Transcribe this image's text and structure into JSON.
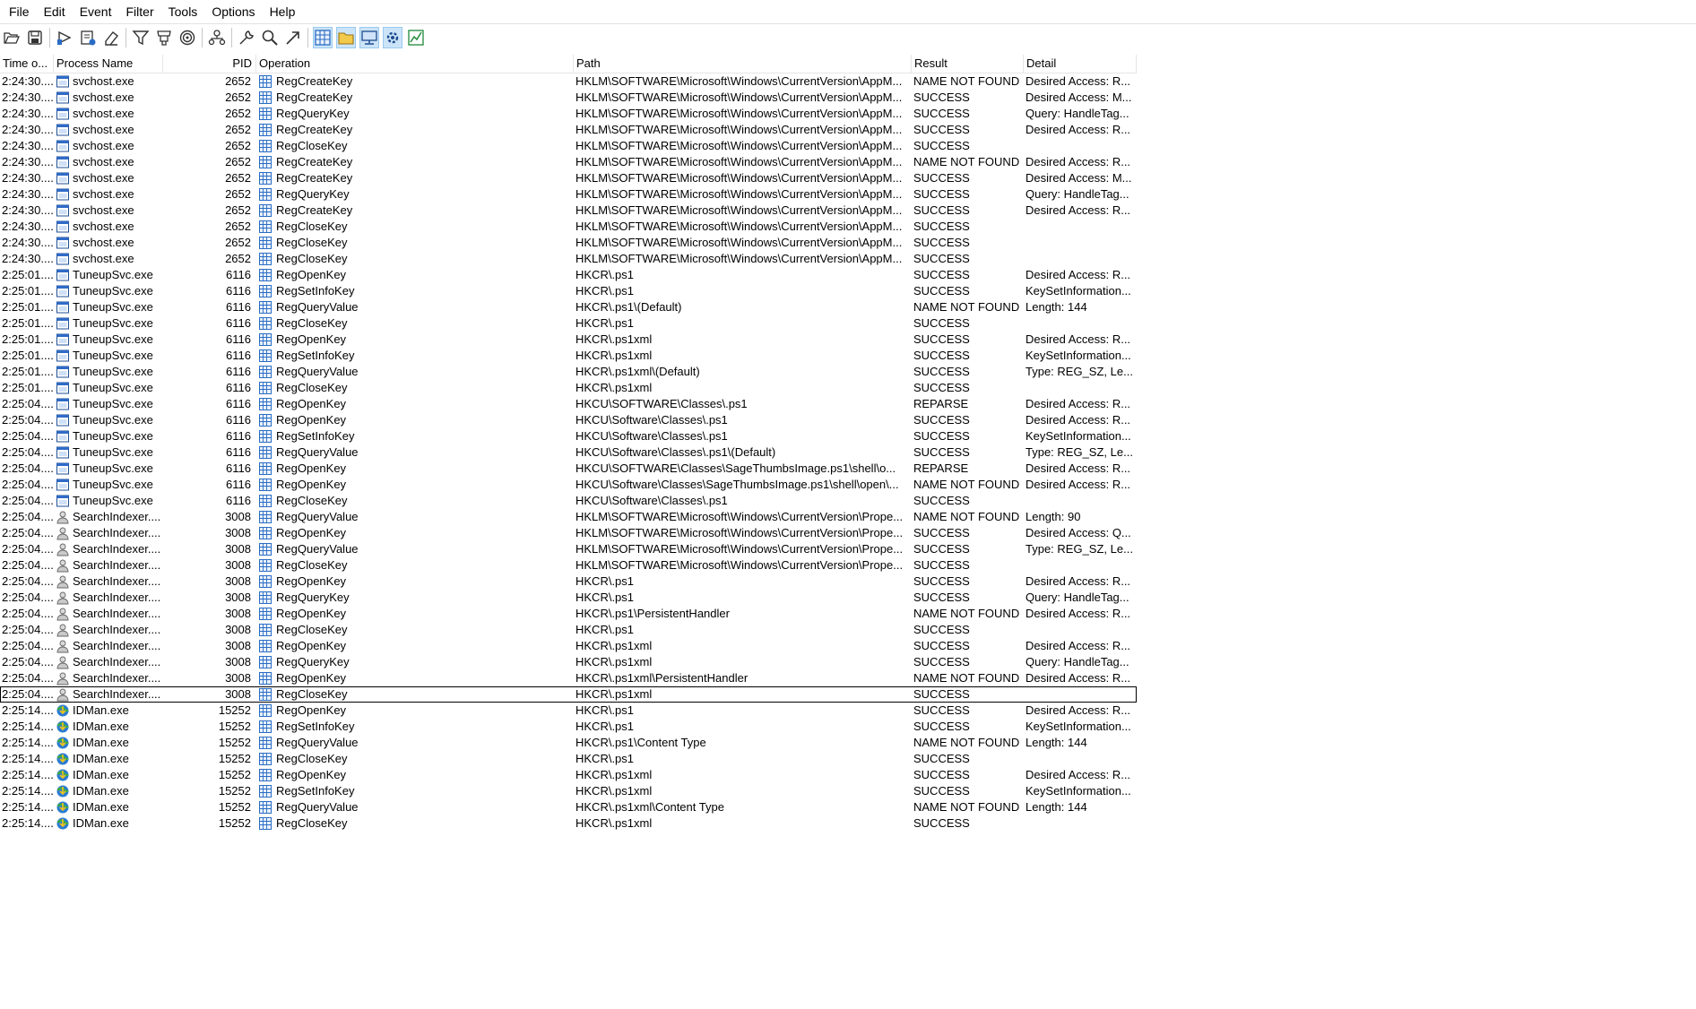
{
  "menu": [
    "File",
    "Edit",
    "Event",
    "Filter",
    "Tools",
    "Options",
    "Help"
  ],
  "columns": {
    "time": "Time o...",
    "process": "Process Name",
    "pid": "PID",
    "operation": "Operation",
    "path": "Path",
    "result": "Result",
    "detail": "Detail"
  },
  "rows": [
    {
      "time": "2:24:30....",
      "proc": "svchost.exe",
      "icon": "svchost-icon",
      "pid": "2652",
      "op": "RegCreateKey",
      "path": "HKLM\\SOFTWARE\\Microsoft\\Windows\\CurrentVersion\\AppM...",
      "result": "NAME NOT FOUND",
      "detail": "Desired Access: R..."
    },
    {
      "time": "2:24:30....",
      "proc": "svchost.exe",
      "icon": "svchost-icon",
      "pid": "2652",
      "op": "RegCreateKey",
      "path": "HKLM\\SOFTWARE\\Microsoft\\Windows\\CurrentVersion\\AppM...",
      "result": "SUCCESS",
      "detail": "Desired Access: M..."
    },
    {
      "time": "2:24:30....",
      "proc": "svchost.exe",
      "icon": "svchost-icon",
      "pid": "2652",
      "op": "RegQueryKey",
      "path": "HKLM\\SOFTWARE\\Microsoft\\Windows\\CurrentVersion\\AppM...",
      "result": "SUCCESS",
      "detail": "Query: HandleTag..."
    },
    {
      "time": "2:24:30....",
      "proc": "svchost.exe",
      "icon": "svchost-icon",
      "pid": "2652",
      "op": "RegCreateKey",
      "path": "HKLM\\SOFTWARE\\Microsoft\\Windows\\CurrentVersion\\AppM...",
      "result": "SUCCESS",
      "detail": "Desired Access: R..."
    },
    {
      "time": "2:24:30....",
      "proc": "svchost.exe",
      "icon": "svchost-icon",
      "pid": "2652",
      "op": "RegCloseKey",
      "path": "HKLM\\SOFTWARE\\Microsoft\\Windows\\CurrentVersion\\AppM...",
      "result": "SUCCESS",
      "detail": ""
    },
    {
      "time": "2:24:30....",
      "proc": "svchost.exe",
      "icon": "svchost-icon",
      "pid": "2652",
      "op": "RegCreateKey",
      "path": "HKLM\\SOFTWARE\\Microsoft\\Windows\\CurrentVersion\\AppM...",
      "result": "NAME NOT FOUND",
      "detail": "Desired Access: R..."
    },
    {
      "time": "2:24:30....",
      "proc": "svchost.exe",
      "icon": "svchost-icon",
      "pid": "2652",
      "op": "RegCreateKey",
      "path": "HKLM\\SOFTWARE\\Microsoft\\Windows\\CurrentVersion\\AppM...",
      "result": "SUCCESS",
      "detail": "Desired Access: M..."
    },
    {
      "time": "2:24:30....",
      "proc": "svchost.exe",
      "icon": "svchost-icon",
      "pid": "2652",
      "op": "RegQueryKey",
      "path": "HKLM\\SOFTWARE\\Microsoft\\Windows\\CurrentVersion\\AppM...",
      "result": "SUCCESS",
      "detail": "Query: HandleTag..."
    },
    {
      "time": "2:24:30....",
      "proc": "svchost.exe",
      "icon": "svchost-icon",
      "pid": "2652",
      "op": "RegCreateKey",
      "path": "HKLM\\SOFTWARE\\Microsoft\\Windows\\CurrentVersion\\AppM...",
      "result": "SUCCESS",
      "detail": "Desired Access: R..."
    },
    {
      "time": "2:24:30....",
      "proc": "svchost.exe",
      "icon": "svchost-icon",
      "pid": "2652",
      "op": "RegCloseKey",
      "path": "HKLM\\SOFTWARE\\Microsoft\\Windows\\CurrentVersion\\AppM...",
      "result": "SUCCESS",
      "detail": ""
    },
    {
      "time": "2:24:30....",
      "proc": "svchost.exe",
      "icon": "svchost-icon",
      "pid": "2652",
      "op": "RegCloseKey",
      "path": "HKLM\\SOFTWARE\\Microsoft\\Windows\\CurrentVersion\\AppM...",
      "result": "SUCCESS",
      "detail": ""
    },
    {
      "time": "2:24:30....",
      "proc": "svchost.exe",
      "icon": "svchost-icon",
      "pid": "2652",
      "op": "RegCloseKey",
      "path": "HKLM\\SOFTWARE\\Microsoft\\Windows\\CurrentVersion\\AppM...",
      "result": "SUCCESS",
      "detail": ""
    },
    {
      "time": "2:25:01....",
      "proc": "TuneupSvc.exe",
      "icon": "svchost-icon",
      "pid": "6116",
      "op": "RegOpenKey",
      "path": "HKCR\\.ps1",
      "result": "SUCCESS",
      "detail": "Desired Access: R..."
    },
    {
      "time": "2:25:01....",
      "proc": "TuneupSvc.exe",
      "icon": "svchost-icon",
      "pid": "6116",
      "op": "RegSetInfoKey",
      "path": "HKCR\\.ps1",
      "result": "SUCCESS",
      "detail": "KeySetInformation..."
    },
    {
      "time": "2:25:01....",
      "proc": "TuneupSvc.exe",
      "icon": "svchost-icon",
      "pid": "6116",
      "op": "RegQueryValue",
      "path": "HKCR\\.ps1\\(Default)",
      "result": "NAME NOT FOUND",
      "detail": "Length: 144"
    },
    {
      "time": "2:25:01....",
      "proc": "TuneupSvc.exe",
      "icon": "svchost-icon",
      "pid": "6116",
      "op": "RegCloseKey",
      "path": "HKCR\\.ps1",
      "result": "SUCCESS",
      "detail": ""
    },
    {
      "time": "2:25:01....",
      "proc": "TuneupSvc.exe",
      "icon": "svchost-icon",
      "pid": "6116",
      "op": "RegOpenKey",
      "path": "HKCR\\.ps1xml",
      "result": "SUCCESS",
      "detail": "Desired Access: R..."
    },
    {
      "time": "2:25:01....",
      "proc": "TuneupSvc.exe",
      "icon": "svchost-icon",
      "pid": "6116",
      "op": "RegSetInfoKey",
      "path": "HKCR\\.ps1xml",
      "result": "SUCCESS",
      "detail": "KeySetInformation..."
    },
    {
      "time": "2:25:01....",
      "proc": "TuneupSvc.exe",
      "icon": "svchost-icon",
      "pid": "6116",
      "op": "RegQueryValue",
      "path": "HKCR\\.ps1xml\\(Default)",
      "result": "SUCCESS",
      "detail": "Type: REG_SZ, Le..."
    },
    {
      "time": "2:25:01....",
      "proc": "TuneupSvc.exe",
      "icon": "svchost-icon",
      "pid": "6116",
      "op": "RegCloseKey",
      "path": "HKCR\\.ps1xml",
      "result": "SUCCESS",
      "detail": ""
    },
    {
      "time": "2:25:04....",
      "proc": "TuneupSvc.exe",
      "icon": "svchost-icon",
      "pid": "6116",
      "op": "RegOpenKey",
      "path": "HKCU\\SOFTWARE\\Classes\\.ps1",
      "result": "REPARSE",
      "detail": "Desired Access: R..."
    },
    {
      "time": "2:25:04....",
      "proc": "TuneupSvc.exe",
      "icon": "svchost-icon",
      "pid": "6116",
      "op": "RegOpenKey",
      "path": "HKCU\\Software\\Classes\\.ps1",
      "result": "SUCCESS",
      "detail": "Desired Access: R..."
    },
    {
      "time": "2:25:04....",
      "proc": "TuneupSvc.exe",
      "icon": "svchost-icon",
      "pid": "6116",
      "op": "RegSetInfoKey",
      "path": "HKCU\\Software\\Classes\\.ps1",
      "result": "SUCCESS",
      "detail": "KeySetInformation..."
    },
    {
      "time": "2:25:04....",
      "proc": "TuneupSvc.exe",
      "icon": "svchost-icon",
      "pid": "6116",
      "op": "RegQueryValue",
      "path": "HKCU\\Software\\Classes\\.ps1\\(Default)",
      "result": "SUCCESS",
      "detail": "Type: REG_SZ, Le..."
    },
    {
      "time": "2:25:04....",
      "proc": "TuneupSvc.exe",
      "icon": "svchost-icon",
      "pid": "6116",
      "op": "RegOpenKey",
      "path": "HKCU\\SOFTWARE\\Classes\\SageThumbsImage.ps1\\shell\\o...",
      "result": "REPARSE",
      "detail": "Desired Access: R..."
    },
    {
      "time": "2:25:04....",
      "proc": "TuneupSvc.exe",
      "icon": "svchost-icon",
      "pid": "6116",
      "op": "RegOpenKey",
      "path": "HKCU\\Software\\Classes\\SageThumbsImage.ps1\\shell\\open\\...",
      "result": "NAME NOT FOUND",
      "detail": "Desired Access: R..."
    },
    {
      "time": "2:25:04....",
      "proc": "TuneupSvc.exe",
      "icon": "svchost-icon",
      "pid": "6116",
      "op": "RegCloseKey",
      "path": "HKCU\\Software\\Classes\\.ps1",
      "result": "SUCCESS",
      "detail": ""
    },
    {
      "time": "2:25:04....",
      "proc": "SearchIndexer....",
      "icon": "search-indexer-icon",
      "pid": "3008",
      "op": "RegQueryValue",
      "path": "HKLM\\SOFTWARE\\Microsoft\\Windows\\CurrentVersion\\Prope...",
      "result": "NAME NOT FOUND",
      "detail": "Length: 90"
    },
    {
      "time": "2:25:04....",
      "proc": "SearchIndexer....",
      "icon": "search-indexer-icon",
      "pid": "3008",
      "op": "RegOpenKey",
      "path": "HKLM\\SOFTWARE\\Microsoft\\Windows\\CurrentVersion\\Prope...",
      "result": "SUCCESS",
      "detail": "Desired Access: Q..."
    },
    {
      "time": "2:25:04....",
      "proc": "SearchIndexer....",
      "icon": "search-indexer-icon",
      "pid": "3008",
      "op": "RegQueryValue",
      "path": "HKLM\\SOFTWARE\\Microsoft\\Windows\\CurrentVersion\\Prope...",
      "result": "SUCCESS",
      "detail": "Type: REG_SZ, Le..."
    },
    {
      "time": "2:25:04....",
      "proc": "SearchIndexer....",
      "icon": "search-indexer-icon",
      "pid": "3008",
      "op": "RegCloseKey",
      "path": "HKLM\\SOFTWARE\\Microsoft\\Windows\\CurrentVersion\\Prope...",
      "result": "SUCCESS",
      "detail": ""
    },
    {
      "time": "2:25:04....",
      "proc": "SearchIndexer....",
      "icon": "search-indexer-icon",
      "pid": "3008",
      "op": "RegOpenKey",
      "path": "HKCR\\.ps1",
      "result": "SUCCESS",
      "detail": "Desired Access: R..."
    },
    {
      "time": "2:25:04....",
      "proc": "SearchIndexer....",
      "icon": "search-indexer-icon",
      "pid": "3008",
      "op": "RegQueryKey",
      "path": "HKCR\\.ps1",
      "result": "SUCCESS",
      "detail": "Query: HandleTag..."
    },
    {
      "time": "2:25:04....",
      "proc": "SearchIndexer....",
      "icon": "search-indexer-icon",
      "pid": "3008",
      "op": "RegOpenKey",
      "path": "HKCR\\.ps1\\PersistentHandler",
      "result": "NAME NOT FOUND",
      "detail": "Desired Access: R..."
    },
    {
      "time": "2:25:04....",
      "proc": "SearchIndexer....",
      "icon": "search-indexer-icon",
      "pid": "3008",
      "op": "RegCloseKey",
      "path": "HKCR\\.ps1",
      "result": "SUCCESS",
      "detail": ""
    },
    {
      "time": "2:25:04....",
      "proc": "SearchIndexer....",
      "icon": "search-indexer-icon",
      "pid": "3008",
      "op": "RegOpenKey",
      "path": "HKCR\\.ps1xml",
      "result": "SUCCESS",
      "detail": "Desired Access: R..."
    },
    {
      "time": "2:25:04....",
      "proc": "SearchIndexer....",
      "icon": "search-indexer-icon",
      "pid": "3008",
      "op": "RegQueryKey",
      "path": "HKCR\\.ps1xml",
      "result": "SUCCESS",
      "detail": "Query: HandleTag..."
    },
    {
      "time": "2:25:04....",
      "proc": "SearchIndexer....",
      "icon": "search-indexer-icon",
      "pid": "3008",
      "op": "RegOpenKey",
      "path": "HKCR\\.ps1xml\\PersistentHandler",
      "result": "NAME NOT FOUND",
      "detail": "Desired Access: R..."
    },
    {
      "time": "2:25:04....",
      "proc": "SearchIndexer....",
      "icon": "search-indexer-icon",
      "pid": "3008",
      "op": "RegCloseKey",
      "path": "HKCR\\.ps1xml",
      "result": "SUCCESS",
      "detail": "",
      "selected": true
    },
    {
      "time": "2:25:14....",
      "proc": "IDMan.exe",
      "icon": "idman-icon",
      "pid": "15252",
      "op": "RegOpenKey",
      "path": "HKCR\\.ps1",
      "result": "SUCCESS",
      "detail": "Desired Access: R..."
    },
    {
      "time": "2:25:14....",
      "proc": "IDMan.exe",
      "icon": "idman-icon",
      "pid": "15252",
      "op": "RegSetInfoKey",
      "path": "HKCR\\.ps1",
      "result": "SUCCESS",
      "detail": "KeySetInformation..."
    },
    {
      "time": "2:25:14....",
      "proc": "IDMan.exe",
      "icon": "idman-icon",
      "pid": "15252",
      "op": "RegQueryValue",
      "path": "HKCR\\.ps1\\Content Type",
      "result": "NAME NOT FOUND",
      "detail": "Length: 144"
    },
    {
      "time": "2:25:14....",
      "proc": "IDMan.exe",
      "icon": "idman-icon",
      "pid": "15252",
      "op": "RegCloseKey",
      "path": "HKCR\\.ps1",
      "result": "SUCCESS",
      "detail": ""
    },
    {
      "time": "2:25:14....",
      "proc": "IDMan.exe",
      "icon": "idman-icon",
      "pid": "15252",
      "op": "RegOpenKey",
      "path": "HKCR\\.ps1xml",
      "result": "SUCCESS",
      "detail": "Desired Access: R..."
    },
    {
      "time": "2:25:14....",
      "proc": "IDMan.exe",
      "icon": "idman-icon",
      "pid": "15252",
      "op": "RegSetInfoKey",
      "path": "HKCR\\.ps1xml",
      "result": "SUCCESS",
      "detail": "KeySetInformation..."
    },
    {
      "time": "2:25:14....",
      "proc": "IDMan.exe",
      "icon": "idman-icon",
      "pid": "15252",
      "op": "RegQueryValue",
      "path": "HKCR\\.ps1xml\\Content Type",
      "result": "NAME NOT FOUND",
      "detail": "Length: 144"
    },
    {
      "time": "2:25:14....",
      "proc": "IDMan.exe",
      "icon": "idman-icon",
      "pid": "15252",
      "op": "RegCloseKey",
      "path": "HKCR\\.ps1xml",
      "result": "SUCCESS",
      "detail": ""
    }
  ]
}
